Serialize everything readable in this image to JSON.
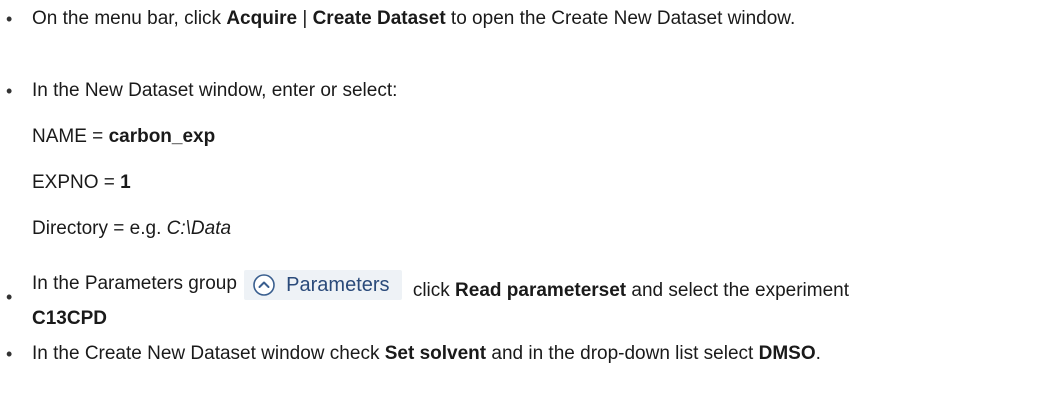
{
  "steps": [
    {
      "bullet": "•",
      "pre": "On the menu bar, click ",
      "menu": "Acquire",
      "sep": " | ",
      "item": "Create Dataset",
      "post": " to open the Create New Dataset window."
    },
    {
      "bullet": "•",
      "text": "In the New Dataset window, enter or select:"
    },
    {
      "bullet": "•",
      "pre": "In the Parameters group ",
      "button_label": "Parameters",
      "button_icon": "chevron-up-circle-icon",
      "mid": " click ",
      "action": "Read parameterset",
      "mid2": " and select the experiment ",
      "experiment": "C13CPD"
    },
    {
      "bullet": "•",
      "pre": "In the Create New Dataset window check ",
      "option": "Set solvent",
      "mid": " and in the drop-down list select ",
      "solvent": "DMSO",
      "post": "."
    }
  ],
  "fields": {
    "name_label": "NAME = ",
    "name_value": "carbon_exp",
    "expno_label": "EXPNO = ",
    "expno_value": "1",
    "dir_label": "Directory = e.g. ",
    "dir_value": "C:\\Data"
  }
}
